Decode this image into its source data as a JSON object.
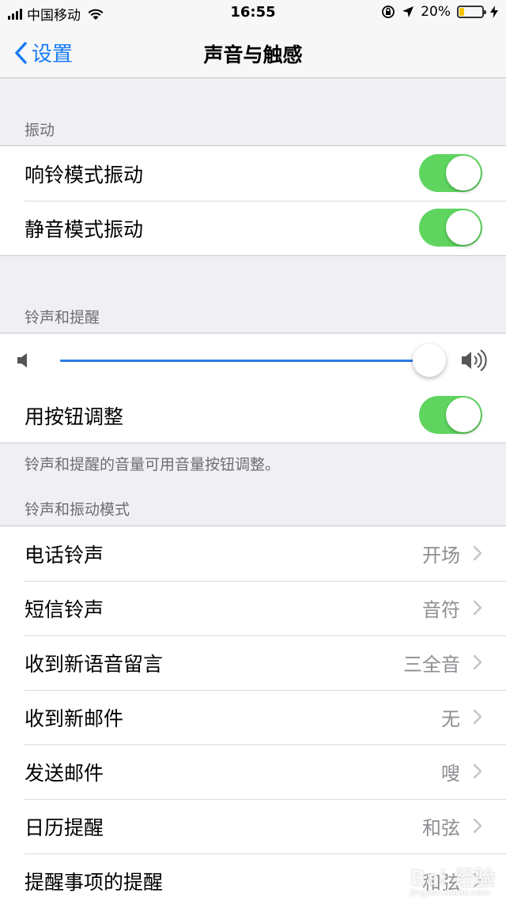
{
  "status_bar": {
    "carrier": "中国移动",
    "time": "16:55",
    "battery_percent": "20%",
    "battery_level": 0.2,
    "battery_color": "#f5c400",
    "icons": [
      "signal-icon",
      "wifi-icon",
      "orientation-lock-icon",
      "location-icon",
      "battery-icon",
      "charging-icon"
    ]
  },
  "nav": {
    "back_label": "设置",
    "title": "声音与触感",
    "accent_color": "#1a7cf5"
  },
  "vibration": {
    "header": "振动",
    "rows": [
      {
        "label": "响铃模式振动",
        "on": true
      },
      {
        "label": "静音模式振动",
        "on": true
      }
    ]
  },
  "ringer": {
    "header": "铃声和提醒",
    "volume_level": 0.96,
    "adjust_label": "用按钮调整",
    "adjust_on": true,
    "footer": "铃声和提醒的音量可用音量按钮调整。"
  },
  "sounds": {
    "header": "铃声和振动模式",
    "rows": [
      {
        "label": "电话铃声",
        "value": "开场"
      },
      {
        "label": "短信铃声",
        "value": "音符"
      },
      {
        "label": "收到新语音留言",
        "value": "三全音"
      },
      {
        "label": "收到新邮件",
        "value": "无"
      },
      {
        "label": "发送邮件",
        "value": "嗖"
      },
      {
        "label": "日历提醒",
        "value": "和弦"
      },
      {
        "label": "提醒事项的提醒",
        "value": "和弦"
      }
    ]
  },
  "toggle_color": "#5fd55f",
  "watermark": {
    "main": "Bai 经验",
    "sub": "jingyan.baidu.com"
  }
}
